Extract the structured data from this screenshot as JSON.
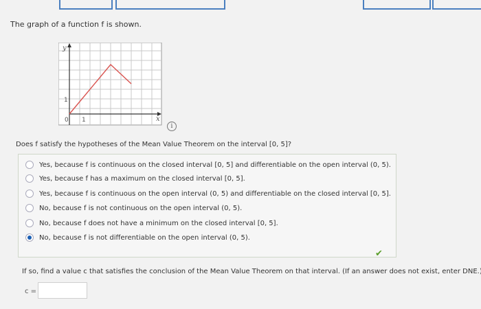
{
  "question": {
    "title": "The graph of a function f is shown.",
    "prompt": "Does f satisfy the hypotheses of the Mean Value Theorem on the interval [0, 5]?",
    "options": [
      {
        "label": "Yes, because f is continuous on the closed interval [0, 5] and differentiable on the open interval (0, 5).",
        "selected": false
      },
      {
        "label": "Yes, because f has a maximum on the closed interval [0, 5].",
        "selected": false
      },
      {
        "label": "Yes, because f is continuous on the open interval (0, 5) and differentiable on the closed interval [0, 5].",
        "selected": false
      },
      {
        "label": "No, because f is not continuous on the open interval (0, 5).",
        "selected": false
      },
      {
        "label": "No, because f does not have a minimum on the closed interval [0, 5].",
        "selected": false
      },
      {
        "label": "No, because f is not differentiable on the open interval (0, 5).",
        "selected": true
      }
    ],
    "followup": "If so, find a value c that satisfies the conclusion of the Mean Value Theorem on that interval. (If an answer does not exist, enter DNE.)",
    "answer_label": "c =",
    "answer_value": ""
  },
  "graph": {
    "y_axis_label": "y",
    "x_axis_label": "x",
    "tick_zero": "0",
    "tick_x1": "1",
    "tick_y1": "1",
    "line_color": "#d9534f"
  },
  "icons": {
    "info": "info-icon",
    "check": "check-icon"
  },
  "symbols": {
    "info": "i",
    "check": "✔"
  }
}
